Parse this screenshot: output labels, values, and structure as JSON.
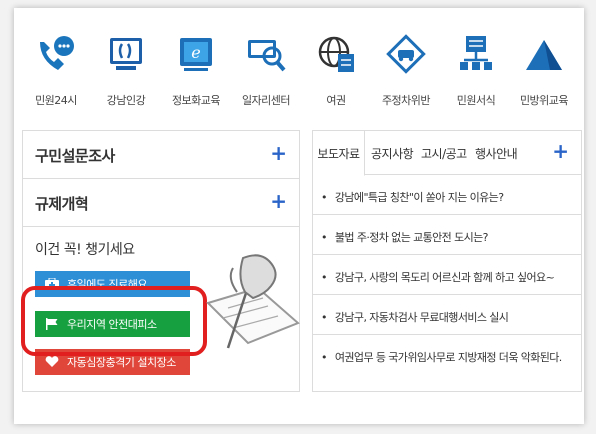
{
  "icons": [
    {
      "name": "civil-24-icon",
      "label": "민원24시",
      "color": "#1b75bc"
    },
    {
      "name": "gangnam-ingang-icon",
      "label": "강남인강",
      "color": "#1d5fa8"
    },
    {
      "name": "info-education-icon",
      "label": "정보화교육",
      "color": "#1d6fb8"
    },
    {
      "name": "job-center-icon",
      "label": "일자리센터",
      "color": "#1d6fb8"
    },
    {
      "name": "passport-icon",
      "label": "여권",
      "color": "#1d6fb8"
    },
    {
      "name": "parking-violation-icon",
      "label": "주정차위반",
      "color": "#1d6fb8"
    },
    {
      "name": "civil-forms-icon",
      "label": "민원서식",
      "color": "#1d6fb8"
    },
    {
      "name": "civil-defense-icon",
      "label": "민방위교육",
      "color": "#1d6fb8"
    }
  ],
  "left": {
    "row1": "구민설문조사",
    "row2": "규제개혁",
    "check_title": "이건 꼭! 챙기세요",
    "btn_blue": "휴일에도 진료해요",
    "btn_green": "우리지역 안전대피소",
    "btn_red": "자동심장충격기 설치장소"
  },
  "plus_symbol": "+",
  "right": {
    "tabs": [
      "보도자료",
      "공지사항",
      "고시/공고",
      "행사안내"
    ],
    "news": [
      "강남에\"특급 칭찬\"이 쏟아 지는 이유는?",
      "불법 주·정차 없는 교통안전 도시는?",
      "강남구, 사랑의 목도리 어르신과 함께 하고 싶어요~",
      "강남구, 자동차검사 무료대행서비스 실시",
      "여권업무 등 국가위임사무로 지방재정 더욱 악화된다."
    ],
    "bullet": "•"
  },
  "colors": {
    "accent": "#2a64c8",
    "highlight": "#e11f1f",
    "green": "#17a03f",
    "blue": "#2e8ed6",
    "red": "#e0463a"
  }
}
